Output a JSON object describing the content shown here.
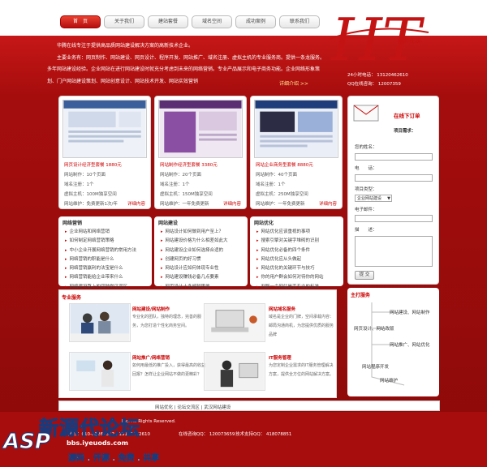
{
  "nav": [
    "首　页",
    "关于我们",
    "建站套餐",
    "域名空间",
    "成功案例",
    "联系我们"
  ],
  "brand": {
    "letters": "HT",
    "name": "华腾在线"
  },
  "contact": {
    "phone_line": "24小时电话： 13120462610",
    "qq_line": "QQ在线咨询： 12007359"
  },
  "intro": {
    "p1": "华腾在线专注于提供高品质网站建设解决方案的高新技术企业。",
    "p2": "主要业务有：网页制作、网站建设、网页设计、程序开发、网站推广、域名注册、虚拟主机的专业服务商。提供一条龙服务。多年网站建设经验。企业网站在进行网站建设时就充分考虑到未来的网络营销。专业产品展示和电子商务功能。企业网络形象策划、门户网站建设策划、网站创意设计、网站技术开发、网站实效营销",
    "more": "详细介绍 >>"
  },
  "templates": [
    {
      "title": "网页设计经济型套餐 1880元",
      "pages": "网站制作：10个页面",
      "domain": "域名注册：1个",
      "host": "虚拟主机：100M独享空间",
      "maint": "网站维护：免费更新1次/年",
      "more": "详细内容"
    },
    {
      "title": "网站制作经济型套餐 3380元",
      "pages": "网站制作：20个页面",
      "domain": "域名注册：1个",
      "host": "虚拟主机：150M独享空间",
      "maint": "网站维护：一年免费更新",
      "more": "详细内容"
    },
    {
      "title": "网站企业商务型套餐 8880元",
      "pages": "网站制作：40个页面",
      "domain": "域名注册：1个",
      "host": "虚拟主机：250M独享空间",
      "maint": "网站维护：一年免费更新",
      "more": "详细内容"
    }
  ],
  "panels": [
    {
      "title": "网络营销",
      "items": [
        "企业网站和网络营销",
        "如何制定网络营销策略",
        "中小企业开展网络营销的常用方法",
        "网络营销的职能是什么",
        "网络营销赢利的法宝是什么",
        "网络营销能给企业带来什么",
        "网络建设路上的四种常见误区"
      ]
    },
    {
      "title": "网站建设",
      "items": [
        "网站设计如何做到用户至上？",
        "网站建设价格为什么相差如此大",
        "网站建设企业如何选择合适的",
        "创建网页的好习惯",
        "网站设计应如何体现专业性",
        "网站建设赚钱必备几点要素",
        "网页设计十多超越思维"
      ]
    },
    {
      "title": "网站优化",
      "items": [
        "网站优化应该重视的事项",
        "搜索引擎对关键字堆砌的识别",
        "网站优化必备的四个条件",
        "网站优化应从头做起",
        "网站优化的关键环节与技巧",
        "你的用户群会如何对待你的网站",
        "判断一个网站是否专业的标准"
      ]
    }
  ],
  "order": {
    "title": "在线下订单",
    "need": "项目需求：",
    "name_label": "您的姓名：",
    "phone_label": "电　　话：",
    "type_label": "项目类型：",
    "type_value": "企业网站建设",
    "email_label": "电子邮件：",
    "desc_label": "描　　述：",
    "submit": "提 交"
  },
  "services": {
    "heading": "专业服务",
    "items": [
      {
        "title": "网站建设/网站制作",
        "text": "专业化的团队，独特的理念，完善的服务，为您打造个性化商务空间。"
      },
      {
        "title": "网站域名服务",
        "text": "域名是企业的门牌，空间承载内容：邮局沟通商机，为您提供优质的服务品牌"
      },
      {
        "title": "网站推广/网络营销",
        "text": "如何用最低的推广投入，获得最高的收益回报？怎样让企业网站不做的更精彩？"
      },
      {
        "title": "IT服务管理",
        "text": "为您定制企业需求的IT服务管理解决方案，提供全方位的网站解决方案。"
      }
    ]
  },
  "core": {
    "title": "主打服务",
    "nodes": [
      "网站建设、网站制作",
      "网页设计、网站改版",
      "网站推广、网站优化",
      "网站程序开发",
      "网站维护"
    ]
  },
  "links": "网站优化 | 论坛交流区 | 武汉网站建设",
  "footer": {
    "rights": "Inc. All Rights Reserved.",
    "tel": "热线：010-83269332　13120462610",
    "qq1": "在线咨询QQ： 120073659",
    "qq2": "技术支持QQ： 418078851"
  },
  "watermark": {
    "big": "新源代论坛",
    "mono": "ASP",
    "url": "bbs.iyeuods.com",
    "slogan": "源码 . 开源 . 免费 . 共享"
  }
}
